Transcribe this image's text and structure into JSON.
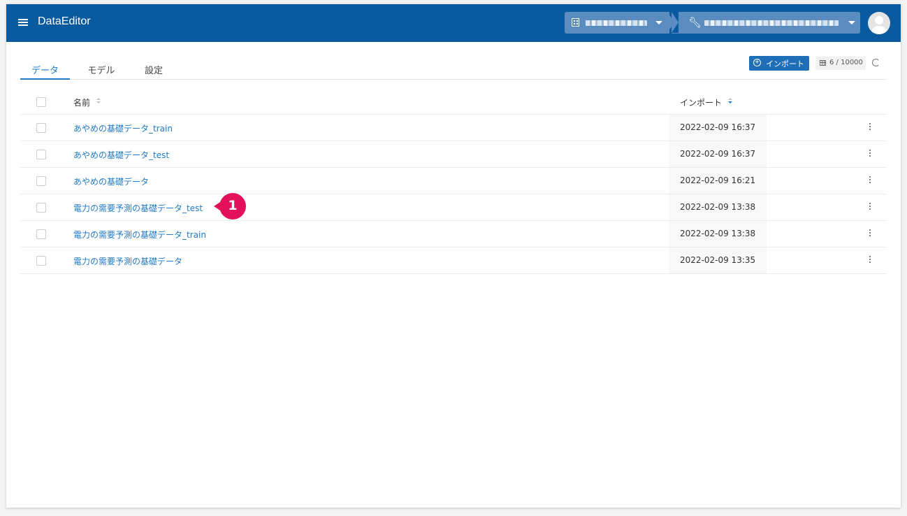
{
  "app": {
    "title": "DataEditor"
  },
  "header": {
    "org_selector": "",
    "project_selector": ""
  },
  "tabs": [
    {
      "label": "データ",
      "active": true
    },
    {
      "label": "モデル",
      "active": false
    },
    {
      "label": "設定",
      "active": false
    }
  ],
  "toolbar": {
    "import_label": "インポート",
    "quota": "6 / 10000"
  },
  "table": {
    "columns": {
      "name": "名前",
      "import": "インポート"
    },
    "rows": [
      {
        "name": "あやめの基礎データ_train",
        "imported": "2022-02-09 16:37"
      },
      {
        "name": "あやめの基礎データ_test",
        "imported": "2022-02-09 16:37"
      },
      {
        "name": "あやめの基礎データ",
        "imported": "2022-02-09 16:21"
      },
      {
        "name": "電力の需要予測の基礎データ_test",
        "imported": "2022-02-09 13:38"
      },
      {
        "name": "電力の需要予測の基礎データ_train",
        "imported": "2022-02-09 13:38"
      },
      {
        "name": "電力の需要予測の基礎データ",
        "imported": "2022-02-09 13:35"
      }
    ]
  },
  "callout": {
    "number": "1"
  },
  "colors": {
    "header_bg": "#0a5aa0",
    "accent": "#1f7ac8",
    "callout": "#e3105a"
  }
}
